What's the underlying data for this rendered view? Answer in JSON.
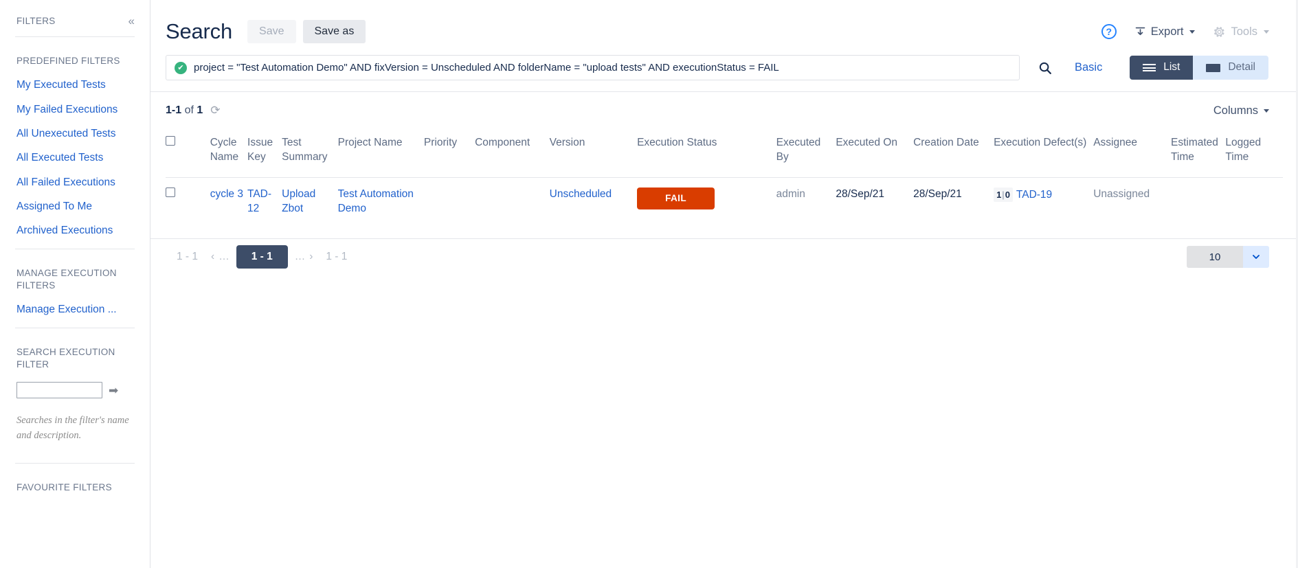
{
  "sidebar": {
    "title": "FILTERS",
    "collapse_icon": "«",
    "predefined_label": "PREDEFINED FILTERS",
    "predefined_items": [
      "My Executed Tests",
      "My Failed Executions",
      "All Unexecuted Tests",
      "All Executed Tests",
      "All Failed Executions",
      "Assigned To Me",
      "Archived Executions"
    ],
    "manage_label": "MANAGE EXECUTION FILTERS",
    "manage_link": "Manage Execution ...",
    "search_label": "SEARCH EXECUTION FILTER",
    "search_value": "",
    "search_placeholder": "",
    "search_submit_icon": "➡",
    "hint": "Searches in the filter's name and description.",
    "favourite_label": "FAVOURITE FILTERS"
  },
  "header": {
    "title": "Search",
    "save_label": "Save",
    "save_as_label": "Save as",
    "help_icon": "?",
    "export_label": "Export",
    "tools_label": "Tools"
  },
  "search": {
    "jql": "project = \"Test Automation Demo\" AND fixVersion = Unscheduled AND folderName = \"upload tests\" AND executionStatus = FAIL",
    "valid_icon": "✔",
    "magnifier_icon": "search-icon",
    "basic_label": "Basic",
    "view_list_label": "List",
    "view_detail_label": "Detail",
    "active_view": "List"
  },
  "results": {
    "count_prefix": "1-1",
    "count_middle": "of",
    "count_total": "1",
    "refresh_icon": "⟳",
    "columns_label": "Columns",
    "headers": [
      "Cycle Name",
      "Issue Key",
      "Test Summary",
      "Project Name",
      "Priority",
      "Component",
      "Version",
      "Execution Status",
      "Executed By",
      "Executed On",
      "Creation Date",
      "Execution Defect(s)",
      "Assignee",
      "Estimated Time",
      "Logged Time"
    ],
    "rows": [
      {
        "cycle_name": "cycle 3",
        "issue_key": "TAD-12",
        "test_summary": "Upload Zbot",
        "project_name": "Test Automation Demo",
        "priority": "",
        "component": "",
        "version": "Unscheduled",
        "execution_status": "FAIL",
        "execution_status_color": "#d93d00",
        "executed_by": "admin",
        "executed_on": "28/Sep/21",
        "creation_date": "28/Sep/21",
        "defect_open": "1",
        "defect_sep": "|",
        "defect_closed": "0",
        "defect_key": "TAD-19",
        "assignee": "Unassigned",
        "estimated_time": "",
        "logged_time": ""
      }
    ]
  },
  "pagination": {
    "first_label": "1 - 1",
    "prev_icon": "‹",
    "prev_ellipsis": "…",
    "current_label": "1 - 1",
    "next_ellipsis": "…",
    "next_icon": "›",
    "last_label": "1 - 1",
    "page_size": "10",
    "page_size_caret": "chevron-down-icon"
  },
  "colors": {
    "link": "#2262cc",
    "fail": "#d93d00",
    "dark_navy": "#3d4d68",
    "valid_green": "#36b37e"
  }
}
